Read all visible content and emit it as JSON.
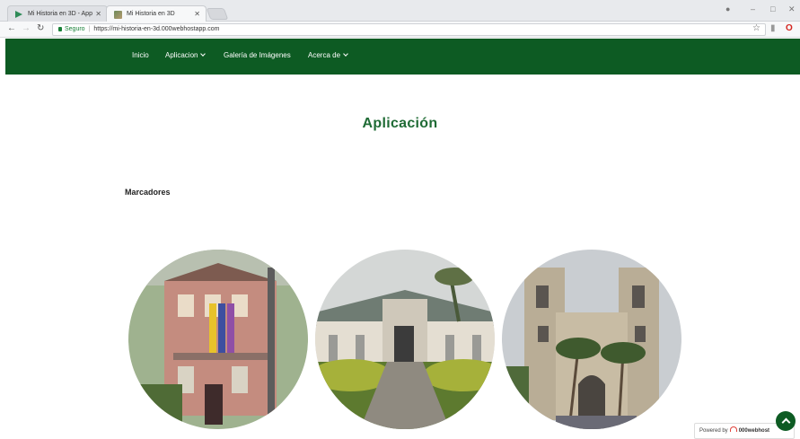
{
  "browser": {
    "tabs": [
      {
        "title": "Mi Historia en 3D - App"
      },
      {
        "title": "Mi Historia en 3D"
      }
    ],
    "security_label": "Seguro",
    "url": "https://mi-historia-en-3d.000webhostapp.com"
  },
  "nav": {
    "items": [
      {
        "label": "Inicio"
      },
      {
        "label": "Aplicacion"
      },
      {
        "label": "Galería de Imágenes"
      },
      {
        "label": "Acerca de"
      }
    ]
  },
  "page": {
    "title": "Aplicación",
    "section_title": "Marcadores"
  },
  "footer": {
    "powered_by": "Powered by",
    "brand": "000webhost"
  },
  "colors": {
    "brand_green": "#0d5b23",
    "title_green": "#1f6b35"
  },
  "icons": [
    "back-icon",
    "forward-icon",
    "reload-icon",
    "lock-icon",
    "star-icon",
    "account-icon",
    "opera-icon",
    "chevron-down-icon",
    "arrow-up-icon"
  ]
}
